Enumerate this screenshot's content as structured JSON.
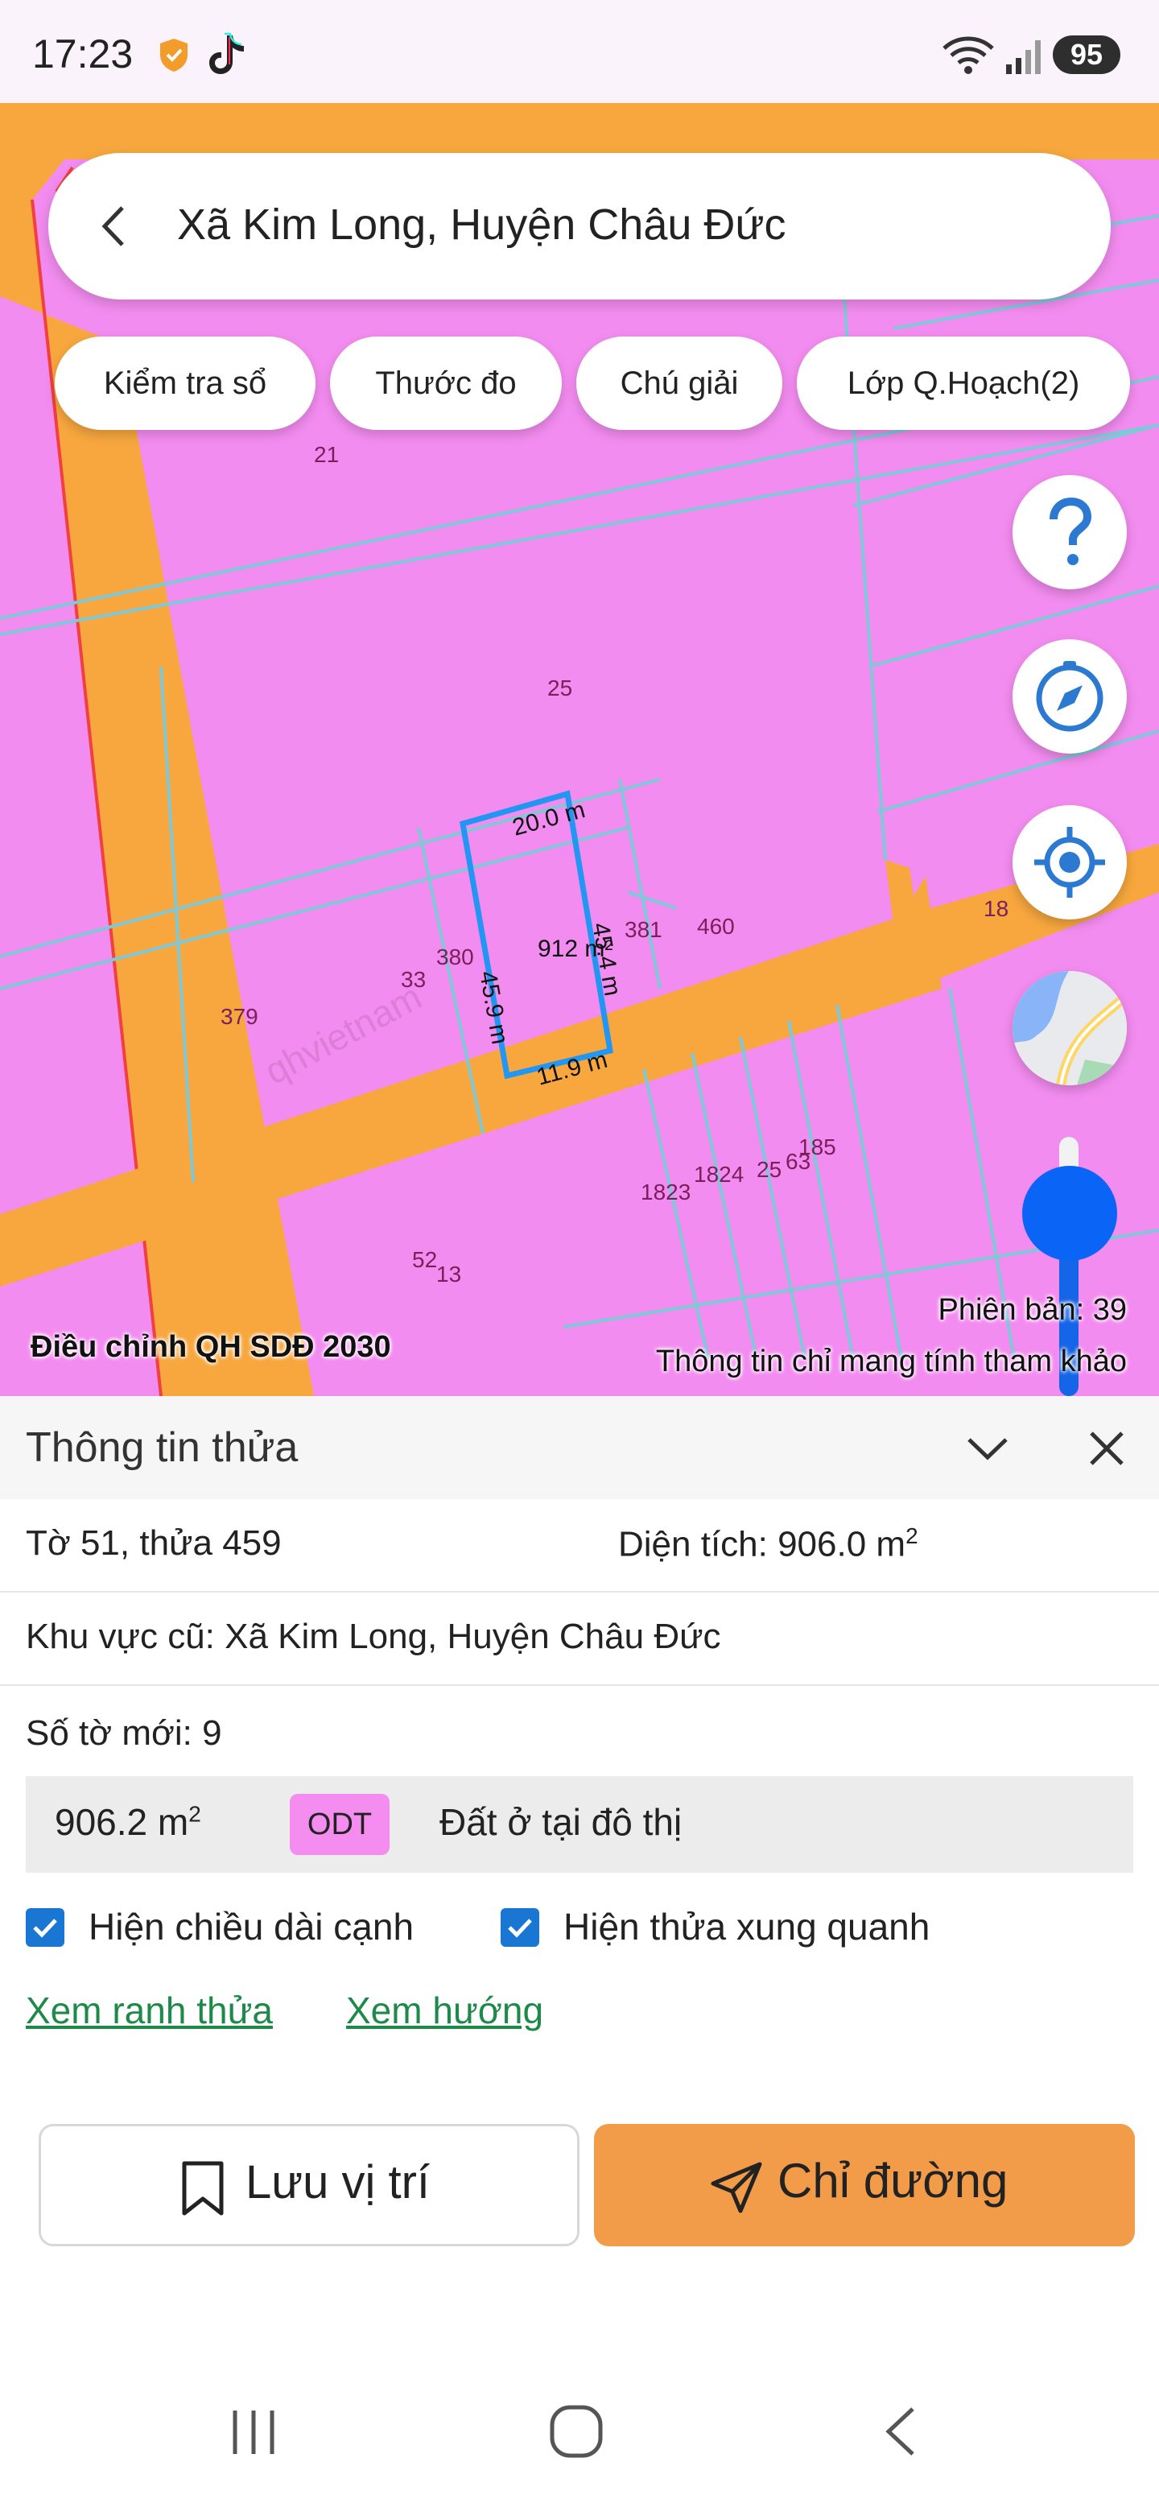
{
  "status_bar": {
    "time": "17:23",
    "battery": "95",
    "icons": [
      "shield-icon",
      "tiktok-icon",
      "wifi-icon",
      "signal-icon"
    ]
  },
  "search": {
    "title": "Xã Kim Long, Huyện Châu Đức"
  },
  "chips": [
    {
      "label": "Kiểm tra sổ"
    },
    {
      "label": "Thước đo"
    },
    {
      "label": "Chú giải"
    },
    {
      "label": "Lớp Q.Hoạch(2)"
    }
  ],
  "map": {
    "layer_label": "Điều chỉnh QH SDĐ 2030",
    "version": "Phiên bản: 39",
    "disclaimer": "Thông tin chỉ mang tính tham khảo",
    "parcel_labels": [
      "21",
      "25",
      "381",
      "460",
      "18",
      "380",
      "33",
      "379",
      "1823",
      "1824",
      "25",
      "63",
      "185",
      "52",
      "13"
    ],
    "measure_labels": {
      "top": "20.0 m",
      "left": "45.9 m",
      "right": "45.4 m",
      "bottom": "11.9 m",
      "area": "912 m²"
    },
    "watermark": "qhvietnam",
    "colors": {
      "residential": "#f38cf0",
      "road": "#f7a73e",
      "parcel_outline": "#2196f3",
      "parcel_lines": "#7fc8d8"
    }
  },
  "sheet": {
    "title": "Thông tin thửa",
    "sheet_parcel": "Tờ 51, thửa 459",
    "area_label": "Diện tích: 906.0 m",
    "area_sup": "2",
    "old_area": "Khu vực cũ: Xã Kim Long, Huyện Châu Đức",
    "new_sheet": "Số tờ mới: 9",
    "landuse": {
      "area": "906.2 m",
      "area_sup": "2",
      "code": "ODT",
      "name": "Đất ở tại đô thị",
      "code_color": "#f58cf0"
    },
    "checkbox_edges": {
      "label": "Hiện chiều dài cạnh",
      "checked": true
    },
    "checkbox_neighbors": {
      "label": "Hiện thửa xung quanh",
      "checked": true
    },
    "link_boundary": "Xem ranh thửa",
    "link_direction": "Xem hướng",
    "save_label": "Lưu vị trí",
    "route_label": "Chỉ đường",
    "accent_color": "#f29c4a"
  }
}
